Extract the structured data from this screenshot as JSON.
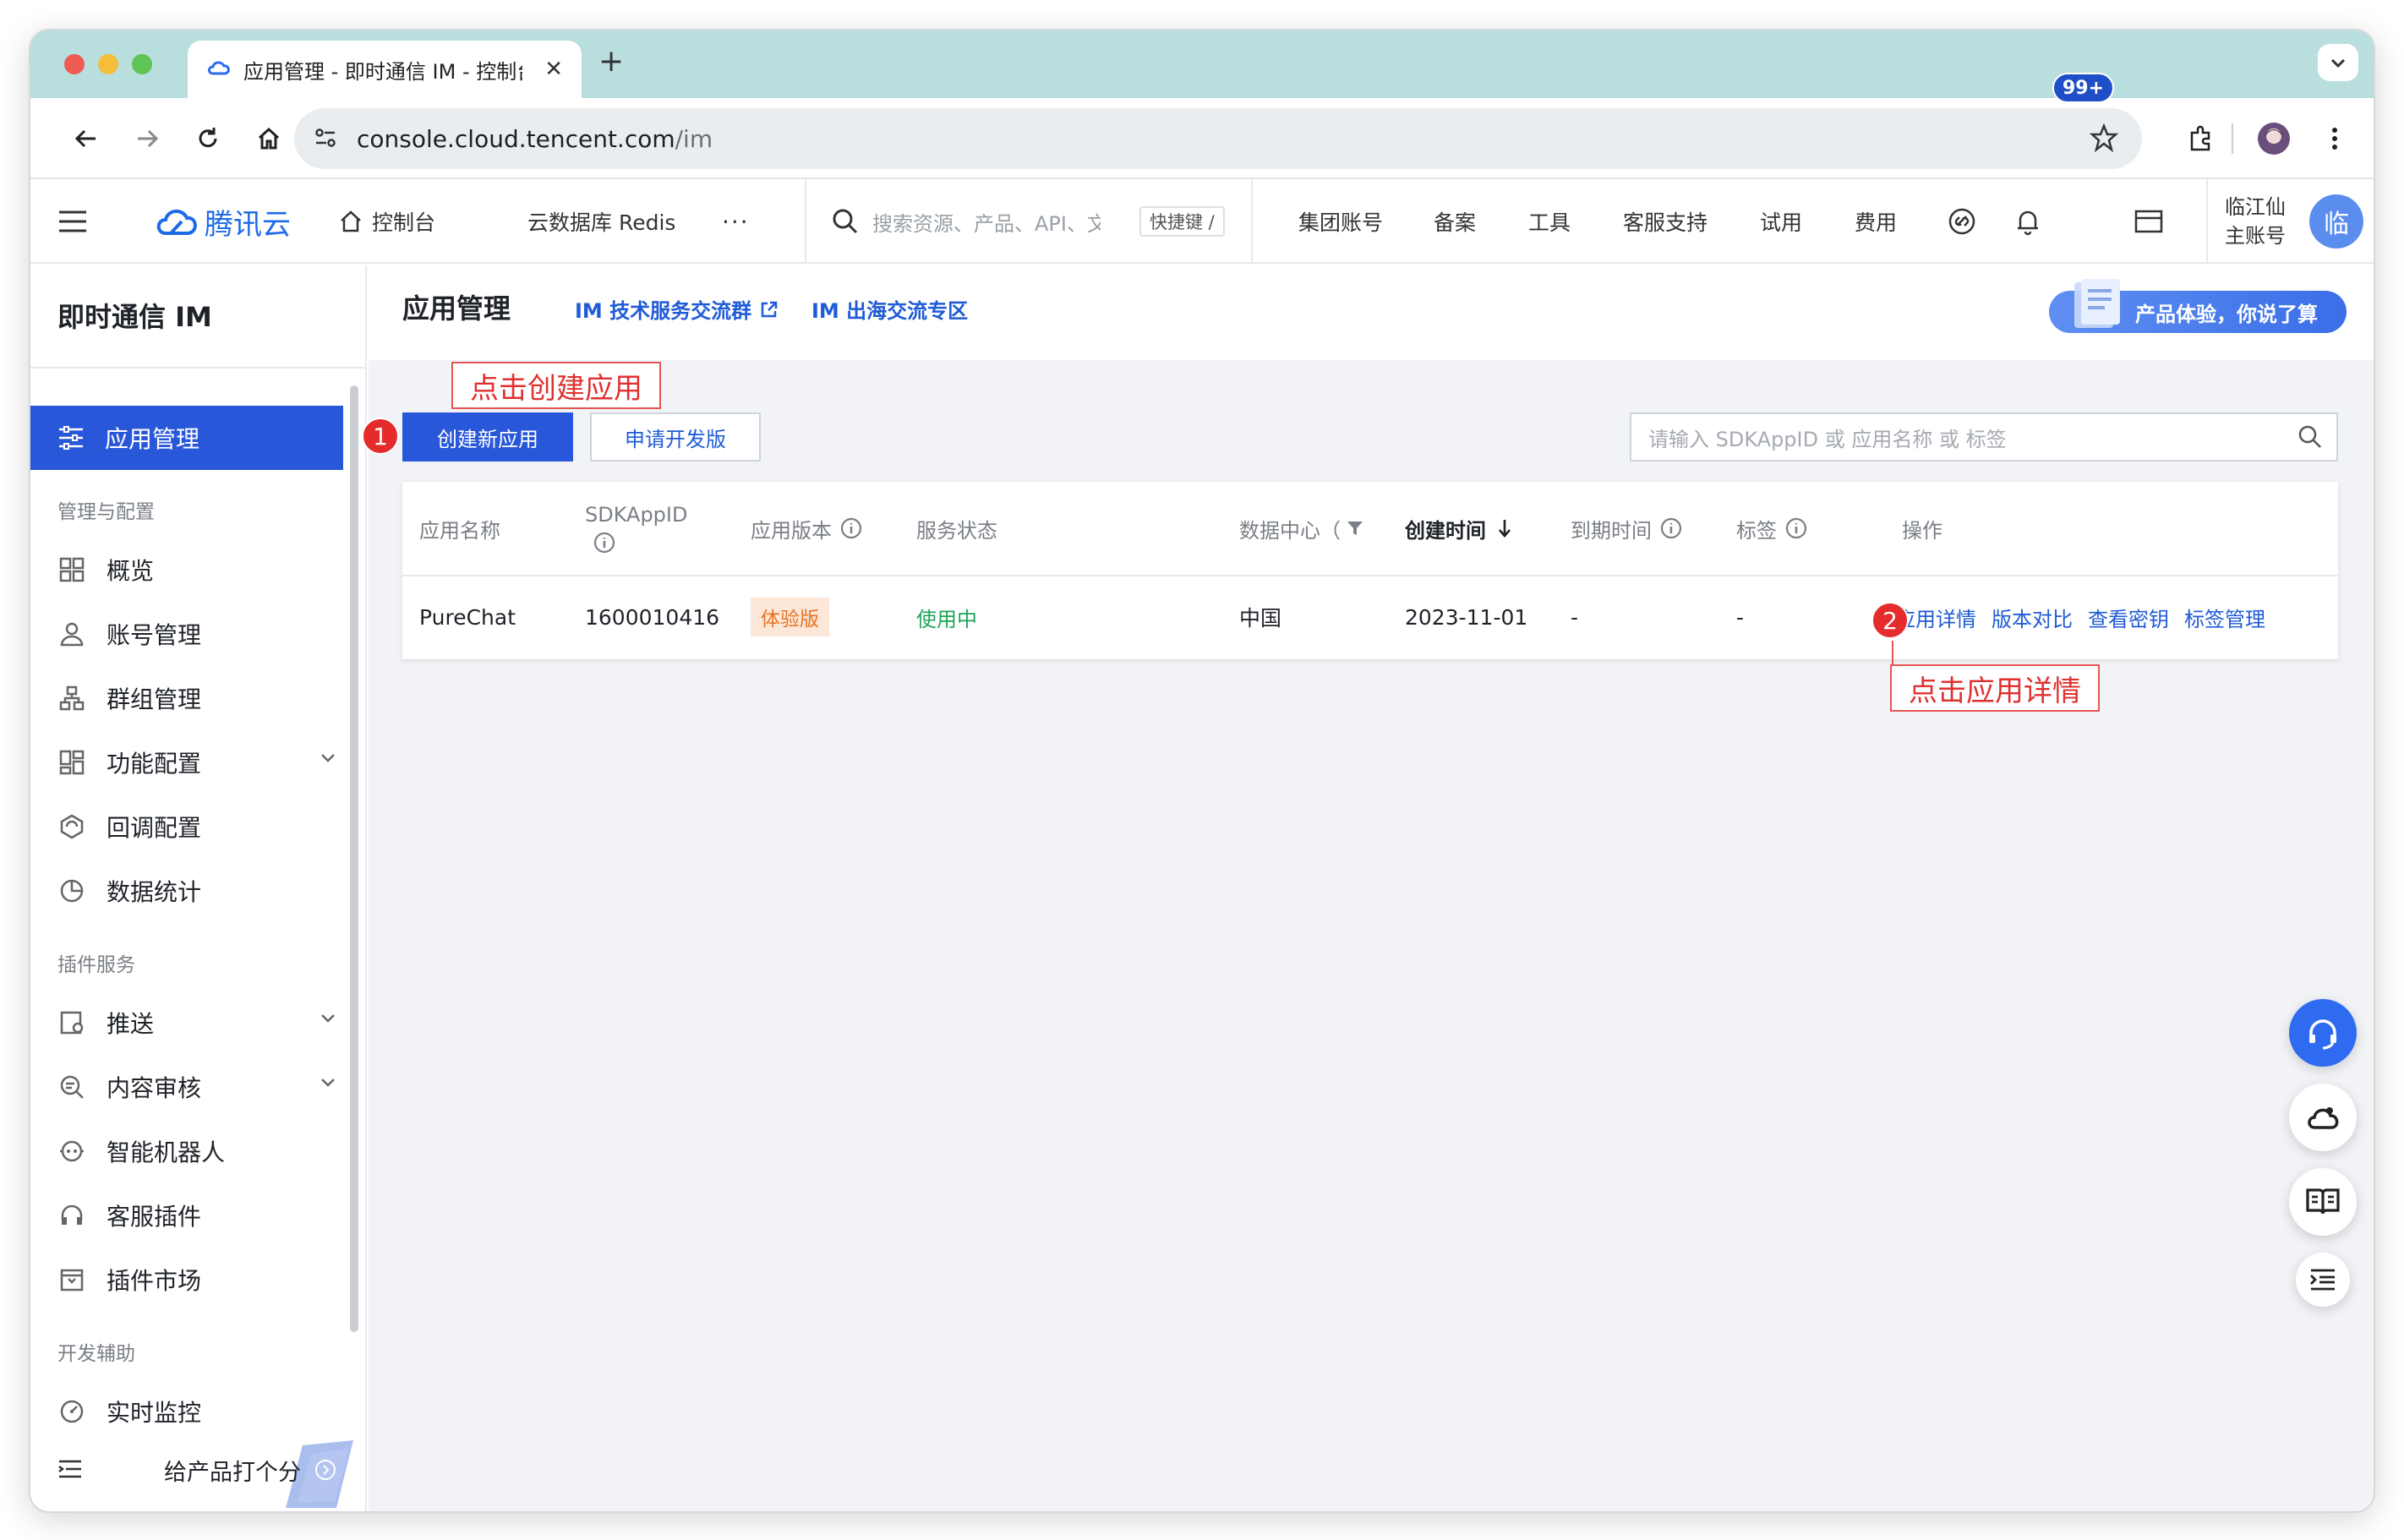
{
  "browser": {
    "tab_title": "应用管理 - 即时通信 IM - 控制台",
    "url_host": "console.cloud.tencent.com",
    "url_path": "/im"
  },
  "topnav": {
    "brand": "腾讯云",
    "console": "控制台",
    "redis": "云数据库 Redis",
    "more": "···",
    "search_placeholder": "搜索资源、产品、API、文档",
    "shortcut": "快捷键 /",
    "items": [
      "集团账号",
      "备案",
      "工具",
      "客服支持",
      "试用",
      "费用"
    ],
    "notification_badge": "99+",
    "user_name": "临江仙",
    "user_role": "主账号",
    "avatar_text": "临"
  },
  "sidebar": {
    "title": "即时通信 IM",
    "active_item": "应用管理",
    "section_config": "管理与配置",
    "config_items": [
      "概览",
      "账号管理",
      "群组管理",
      "功能配置",
      "回调配置",
      "数据统计"
    ],
    "section_plugins": "插件服务",
    "plugin_items": [
      "推送",
      "内容审核",
      "智能机器人",
      "客服插件",
      "插件市场"
    ],
    "section_dev": "开发辅助",
    "dev_items": [
      "实时监控"
    ],
    "rate_label": "给产品打个分"
  },
  "page": {
    "title": "应用管理",
    "link_group": "IM 技术服务交流群",
    "link_overseas": "IM 出海交流专区",
    "feedback": "产品体验，你说了算",
    "create_button": "创建新应用",
    "apply_button": "申请开发版",
    "search_placeholder": "请输入 SDKAppID 或 应用名称 或 标签",
    "callout_create": "点击创建应用",
    "callout_detail": "点击应用详情",
    "step1": "1",
    "step2": "2"
  },
  "table": {
    "headers": {
      "name": "应用名称",
      "sdkappid": "SDKAppID",
      "version": "应用版本",
      "status": "服务状态",
      "datacenter": "数据中心（",
      "created": "创建时间",
      "expire": "到期时间",
      "tags": "标签",
      "ops": "操作"
    },
    "rows": [
      {
        "name": "PureChat",
        "sdkappid": "1600010416",
        "version": "体验版",
        "status": "使用中",
        "datacenter": "中国",
        "created": "2023-11-01",
        "expire": "-",
        "tags": "-",
        "ops": [
          "应用详情",
          "版本对比",
          "查看密钥",
          "标签管理"
        ]
      }
    ]
  },
  "colors": {
    "primary": "#2957d9",
    "link": "#1f5bd6",
    "callout": "#e03030",
    "tabbar": "#b9dede"
  }
}
